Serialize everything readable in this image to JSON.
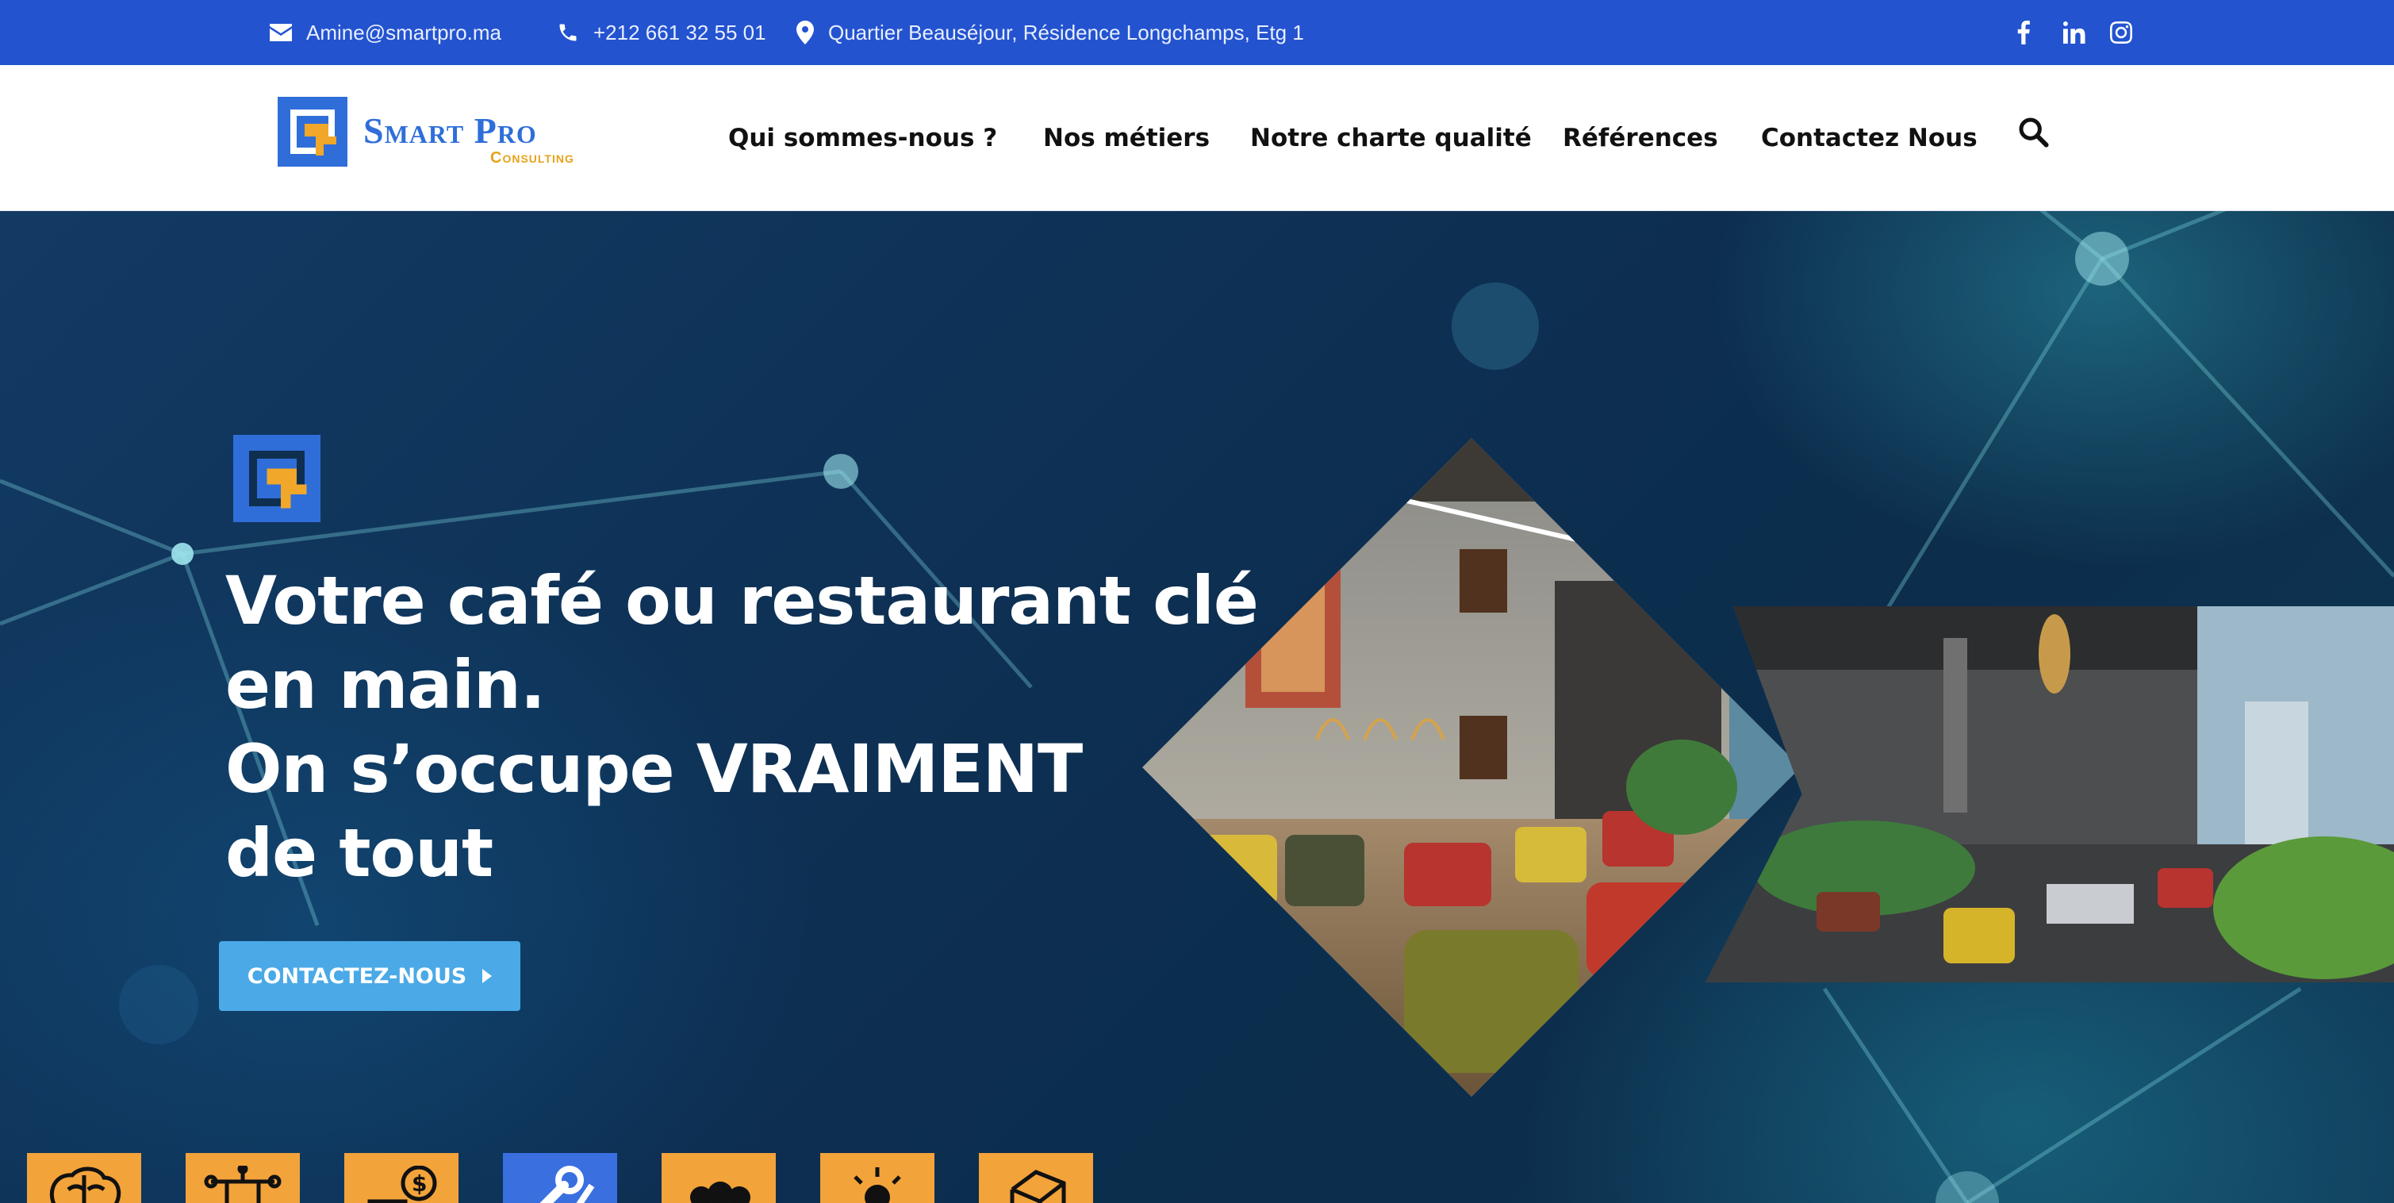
{
  "topbar": {
    "email": "Amine@smartpro.ma",
    "phone": "+212 661 32 55 01",
    "address": "Quartier Beauséjour, Résidence Longchamps, Etg 1",
    "social": [
      "facebook-icon",
      "linkedin-icon",
      "instagram-icon"
    ],
    "color": "#2353cf"
  },
  "header": {
    "logo": {
      "name": "Smart Pro",
      "sub": "Consulting"
    },
    "nav": [
      "Qui sommes-nous ?",
      "Nos métiers",
      "Notre charte qualité",
      "Références",
      "Contactez Nous"
    ],
    "search_icon": "search-icon"
  },
  "hero": {
    "title_lines": [
      "Votre café ou restaurant clé",
      "en main.",
      "On s’occupe VRAIMENT",
      "de tout"
    ],
    "cta_label": "CONTACTEZ-NOUS",
    "images": [
      "restaurant-interior-diamond",
      "restaurant-interior-band"
    ]
  },
  "features": {
    "tiles": [
      {
        "icon": "brain-icon",
        "color": "#f2a33a"
      },
      {
        "icon": "circuit-icon",
        "color": "#f2a33a"
      },
      {
        "icon": "money-icon",
        "color": "#f2a33a"
      },
      {
        "icon": "tools-icon",
        "color": "#3a6fe0"
      },
      {
        "icon": "team-icon",
        "color": "#f2a33a"
      },
      {
        "icon": "idea-icon",
        "color": "#f2a33a"
      },
      {
        "icon": "box-icon",
        "color": "#f2a33a"
      }
    ]
  },
  "colors": {
    "brand_blue": "#2f6ed9",
    "brand_orange": "#e6a31a",
    "cta": "#4aa9e6"
  }
}
